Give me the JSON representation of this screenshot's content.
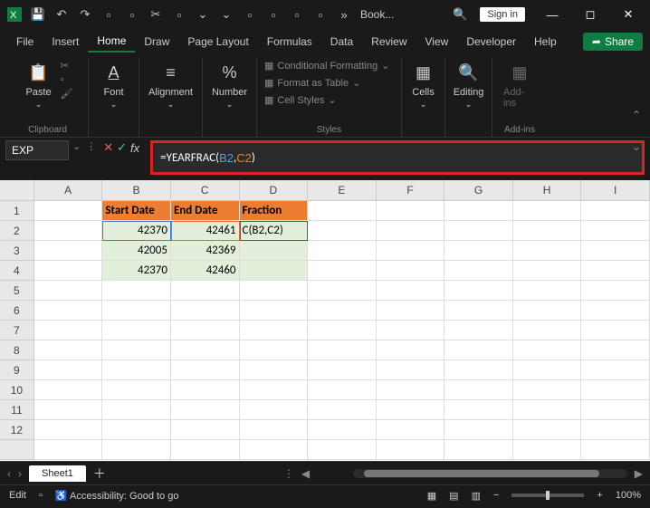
{
  "titlebar": {
    "doc_name": "Book...",
    "signin": "Sign in"
  },
  "menu": {
    "file": "File",
    "insert": "Insert",
    "home": "Home",
    "draw": "Draw",
    "page_layout": "Page Layout",
    "formulas": "Formulas",
    "data": "Data",
    "review": "Review",
    "view": "View",
    "developer": "Developer",
    "help": "Help",
    "share": "Share"
  },
  "ribbon": {
    "paste": "Paste",
    "clipboard": "Clipboard",
    "font": "Font",
    "alignment": "Alignment",
    "number": "Number",
    "cond_fmt": "Conditional Formatting",
    "fmt_table": "Format as Table",
    "cell_styles": "Cell Styles",
    "styles": "Styles",
    "cells": "Cells",
    "editing": "Editing",
    "addins": "Add-ins"
  },
  "namebox": "EXP",
  "formula": "=YEARFRAC(B2,C2)",
  "columns": [
    "A",
    "B",
    "C",
    "D",
    "E",
    "F",
    "G",
    "H",
    "I"
  ],
  "rows": [
    "1",
    "2",
    "3",
    "4",
    "5",
    "6",
    "7",
    "8",
    "9",
    "10",
    "11",
    "12"
  ],
  "table": {
    "headers": {
      "b": "Start Date",
      "c": "End Date",
      "d": "Fraction"
    },
    "data": [
      {
        "b": "42370",
        "c": "42461",
        "d": "C(B2,C2)"
      },
      {
        "b": "42005",
        "c": "42369",
        "d": ""
      },
      {
        "b": "42370",
        "c": "42460",
        "d": ""
      }
    ]
  },
  "sheet": "Sheet1",
  "status": {
    "mode": "Edit",
    "acc": "Accessibility: Good to go",
    "zoom": "100%"
  }
}
